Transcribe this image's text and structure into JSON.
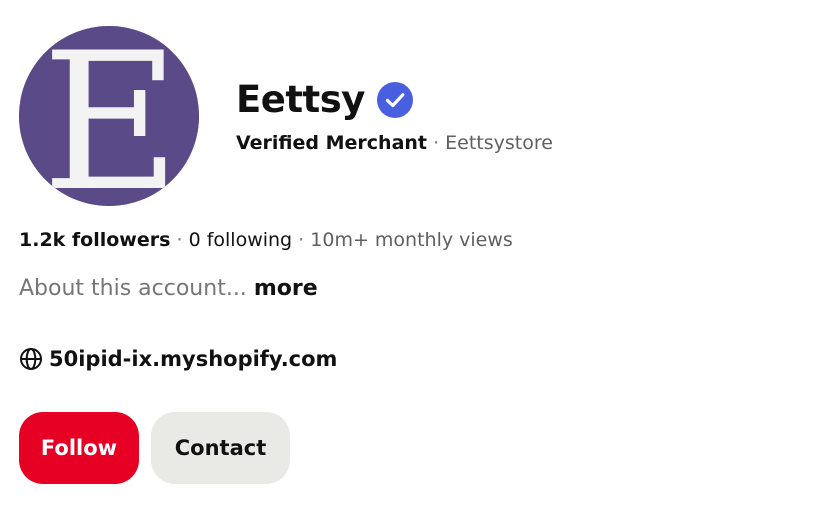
{
  "profile": {
    "name": "Eettsy",
    "verified_icon": "verified-check-icon",
    "merchant_label": "Verified Merchant",
    "separator": "·",
    "handle": "Eettsystore",
    "avatar_letter": "E",
    "avatar_bg": "#5b4a88"
  },
  "stats": {
    "followers": "1.2k followers",
    "following": "0 following",
    "views": "10m+ monthly views"
  },
  "about": {
    "text": "About this account...",
    "more_label": "more"
  },
  "website": {
    "icon": "globe-icon",
    "url": "50ipid-ix.myshopify.com"
  },
  "actions": {
    "follow_label": "Follow",
    "contact_label": "Contact",
    "follow_color": "#e60023",
    "contact_color": "#e9e9e5",
    "verified_color": "#4a5fe0"
  }
}
